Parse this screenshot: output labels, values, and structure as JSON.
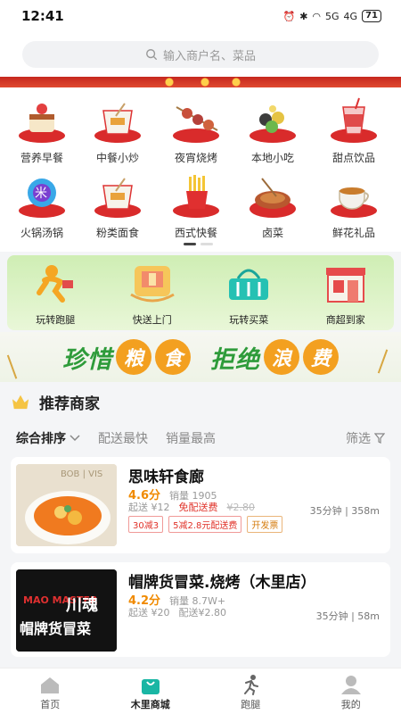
{
  "status_bar": {
    "time": "12:41",
    "signal1": "5G",
    "signal2": "4G",
    "battery": "71"
  },
  "search": {
    "placeholder": "输入商户名、菜品"
  },
  "categories": [
    {
      "label": "营养早餐",
      "icon": "cake-icon"
    },
    {
      "label": "中餐小炒",
      "icon": "takeout-box-icon"
    },
    {
      "label": "夜宵烧烤",
      "icon": "skewer-icon"
    },
    {
      "label": "本地小吃",
      "icon": "snack-icon"
    },
    {
      "label": "甜点饮品",
      "icon": "drink-icon"
    },
    {
      "label": "火锅汤锅",
      "icon": "hotpot-icon"
    },
    {
      "label": "粉类面食",
      "icon": "noodle-box-icon"
    },
    {
      "label": "西式快餐",
      "icon": "fries-icon"
    },
    {
      "label": "卤菜",
      "icon": "braised-dish-icon"
    },
    {
      "label": "鲜花礼品",
      "icon": "teacup-icon"
    }
  ],
  "services": [
    {
      "label": "玩转跑腿",
      "icon": "runner-icon"
    },
    {
      "label": "快送上门",
      "icon": "parcel-icon"
    },
    {
      "label": "玩转买菜",
      "icon": "basket-icon"
    },
    {
      "label": "商超到家",
      "icon": "store-icon"
    }
  ],
  "slogan": {
    "part1": "珍惜",
    "char1": "粮",
    "char2": "食",
    "part2": "拒绝",
    "char3": "浪",
    "char4": "费"
  },
  "recommend": {
    "title": "推荐商家"
  },
  "sort": {
    "active": "综合排序",
    "option1": "配送最快",
    "option2": "销量最高",
    "filter": "筛选"
  },
  "merchants": [
    {
      "name": "思味轩食廊",
      "score": "4.6分",
      "sales": "销量 1905",
      "min_order": "起送 ¥12",
      "delivery": "免配送费",
      "original_fee": "¥2.80",
      "time_distance": "35分钟 | 358m",
      "tags": [
        "30减3",
        "5减2.8元配送费",
        "开发票"
      ],
      "image_text": "BOB | VIS"
    },
    {
      "name": "帽牌货冒菜.烧烤（木里店）",
      "score": "4.2分",
      "sales": "销量 8.7W+",
      "min_order": "起送 ¥20",
      "delivery": "配送¥2.80",
      "time_distance": "35分钟 | 58m",
      "logo_text1": "MAO MASTER",
      "logo_text2": "川魂",
      "logo_text3": "帽牌货冒菜"
    }
  ],
  "bottom_nav": [
    {
      "label": "首页",
      "icon": "home-icon"
    },
    {
      "label": "木里商城",
      "icon": "shopping-bag-icon",
      "active": true
    },
    {
      "label": "跑腿",
      "icon": "runner-icon"
    },
    {
      "label": "我的",
      "icon": "user-icon"
    }
  ],
  "colors": {
    "brand_green": "#2e9b3a",
    "accent_orange": "#f08a00",
    "price_red": "#e0332a",
    "teal": "#19b6a4"
  }
}
